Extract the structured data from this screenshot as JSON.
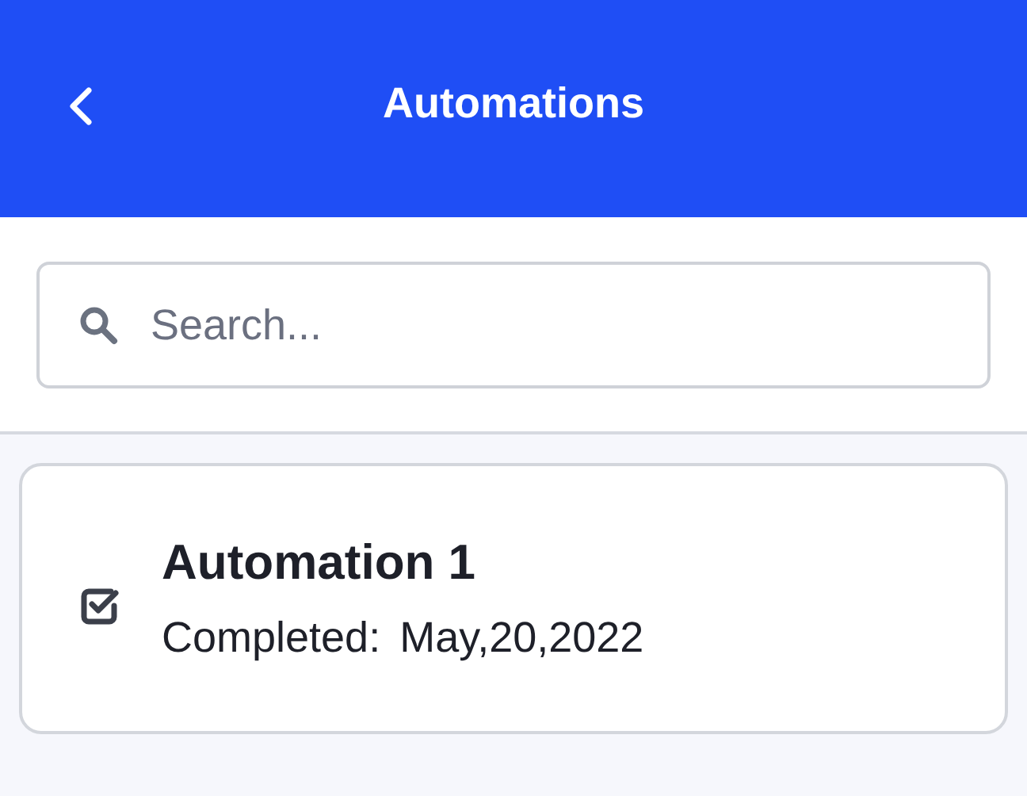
{
  "header": {
    "title": "Automations"
  },
  "search": {
    "placeholder": "Search..."
  },
  "automations": [
    {
      "name": "Automation 1",
      "status_label": "Completed:",
      "date": "May,20,2022"
    }
  ]
}
